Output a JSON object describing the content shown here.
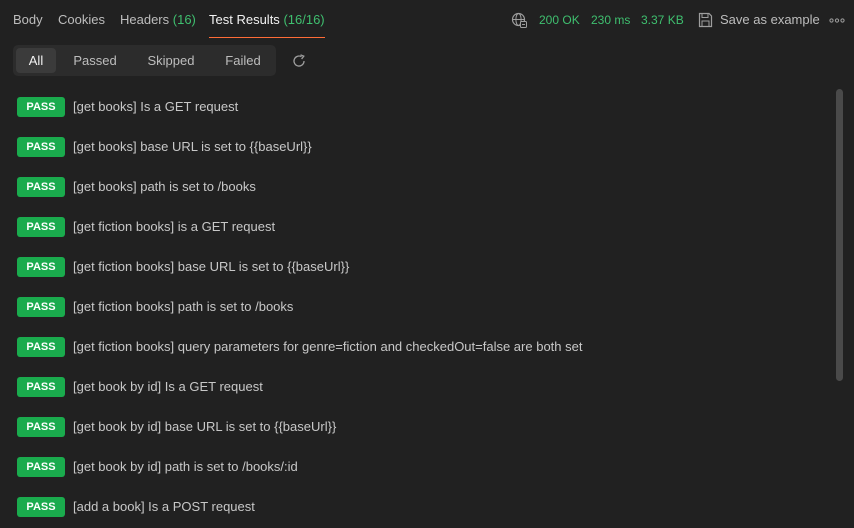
{
  "tabs": [
    {
      "label": "Body",
      "count": ""
    },
    {
      "label": "Cookies",
      "count": ""
    },
    {
      "label": "Headers",
      "count": "(16)"
    },
    {
      "label": "Test Results",
      "count": "(16/16)"
    }
  ],
  "response": {
    "status": "200 OK",
    "time": "230 ms",
    "size": "3.37 KB",
    "save_label": "Save as example"
  },
  "filters": [
    "All",
    "Passed",
    "Skipped",
    "Failed"
  ],
  "active_filter": "All",
  "badge_label": "PASS",
  "results": [
    "[get books] Is a GET request",
    "[get books] base URL is set to {{baseUrl}}",
    "[get books] path is set to /books",
    "[get fiction books] is a GET request",
    "[get fiction books] base URL is set to {{baseUrl}}",
    "[get fiction books] path is set to /books",
    "[get fiction books] query parameters for genre=fiction and checkedOut=false are both set",
    "[get book by id] Is a GET request",
    "[get book by id] base URL is set to {{baseUrl}}",
    "[get book by id] path is set to /books/:id",
    "[add a book] Is a POST request"
  ],
  "colors": {
    "background": "#212121",
    "pass_badge": "#1aab4d",
    "status_green": "#3fbf6f",
    "active_tab_underline": "#ff6c37"
  },
  "icons": [
    "globe-icon",
    "save-icon",
    "more-icon",
    "refresh-icon"
  ]
}
